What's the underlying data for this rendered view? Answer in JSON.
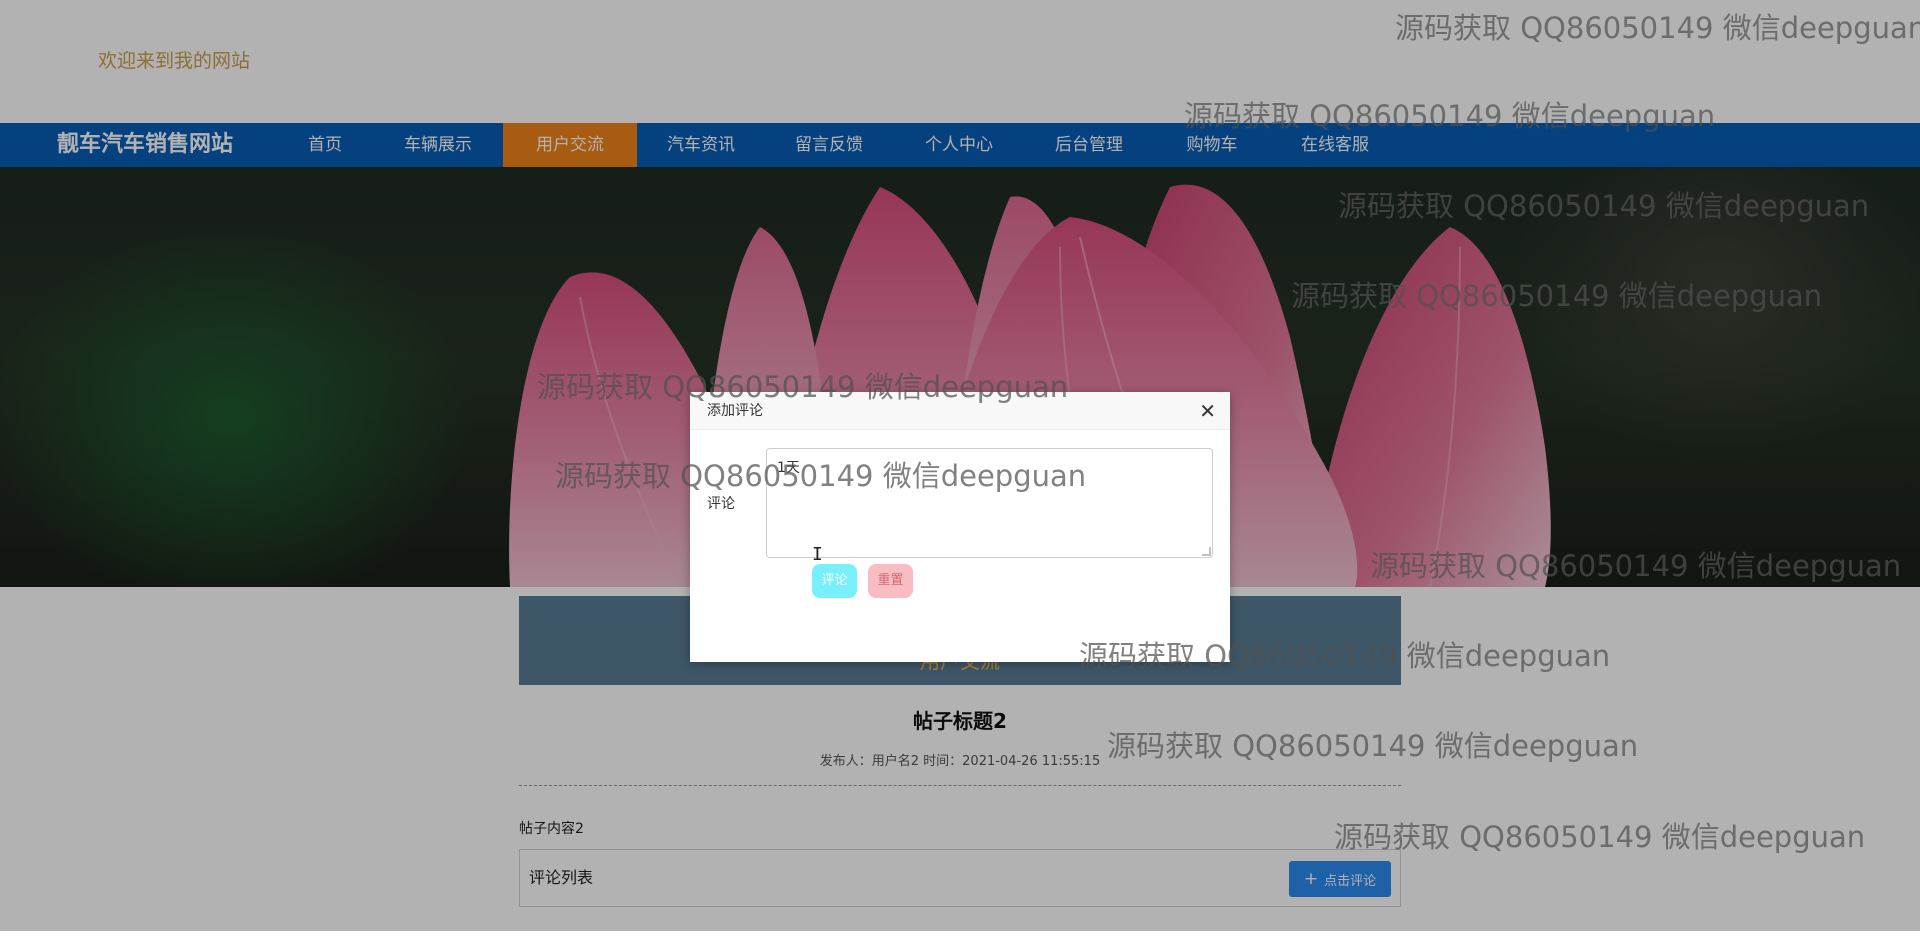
{
  "header": {
    "welcome_text": "欢迎来到我的网站"
  },
  "navbar": {
    "brand": "靓车汽车销售网站",
    "items": [
      {
        "label": "首页"
      },
      {
        "label": "车辆展示"
      },
      {
        "label": "用户交流"
      },
      {
        "label": "汽车资讯"
      },
      {
        "label": "留言反馈"
      },
      {
        "label": "个人中心"
      },
      {
        "label": "后台管理"
      },
      {
        "label": "购物车"
      },
      {
        "label": "在线客服"
      }
    ],
    "active_label": "用户交流",
    "bg_color": "#0a5eb7",
    "active_color": "#f08519"
  },
  "banner": {
    "section_title": "用户交流"
  },
  "post": {
    "title": "帖子标题2",
    "meta": "发布人：用户名2 时间：2021-04-26 11:55:15",
    "content": "帖子内容2"
  },
  "comments": {
    "list_label": "评论列表",
    "add_button_label": "点击评论",
    "add_button_icon": "plus-icon"
  },
  "modal": {
    "title": "添加评论",
    "field_label": "评论",
    "textarea_value": "1天",
    "submit_label": "评论",
    "reset_label": "重置",
    "close_icon": "close-icon"
  },
  "watermark": {
    "text": "源码获取 QQ86050149 微信deepguan"
  }
}
